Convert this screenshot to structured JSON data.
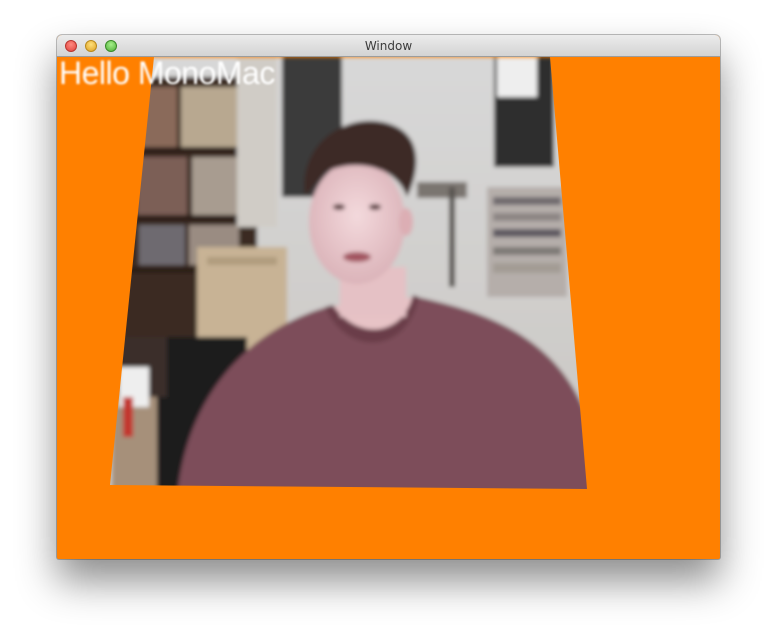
{
  "window": {
    "title": "Window"
  },
  "content": {
    "overlay_text": "Hello MonoMac",
    "background_color": "#ff8000"
  },
  "icons": {
    "close": "close-traffic-light",
    "minimize": "minimize-traffic-light",
    "zoom": "zoom-traffic-light"
  }
}
